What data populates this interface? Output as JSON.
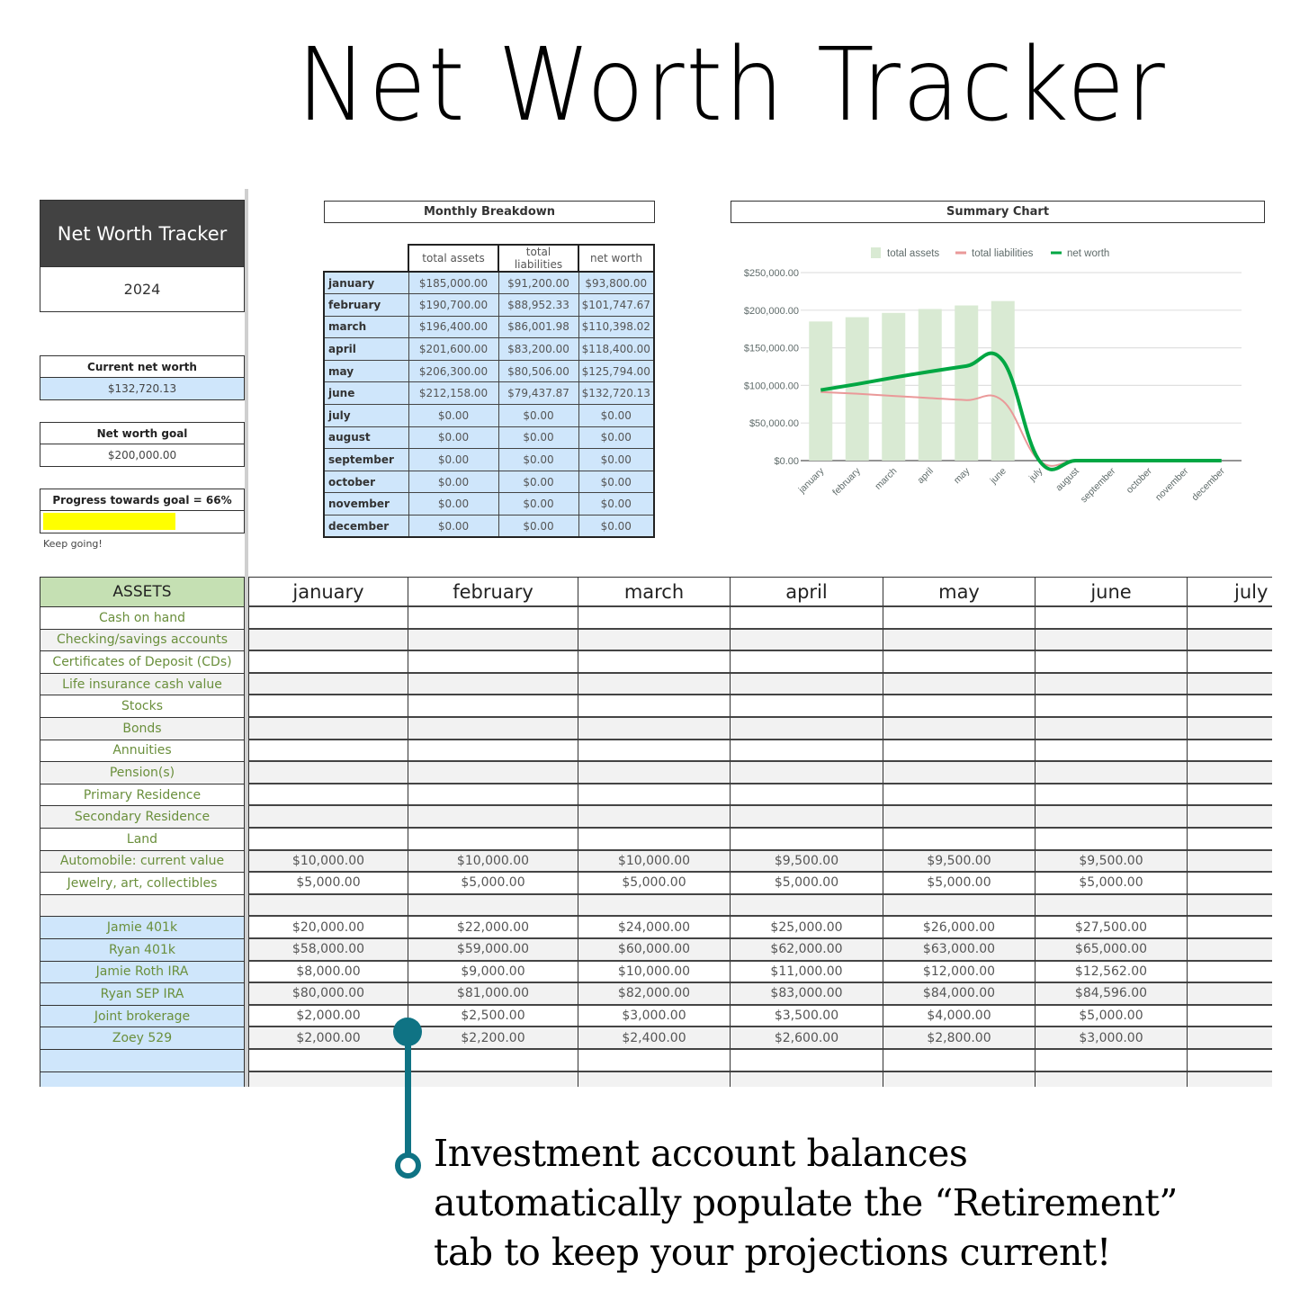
{
  "page": {
    "title": "Net Worth Tracker"
  },
  "summary_panel": {
    "header": "Net Worth Tracker",
    "year": "2024",
    "current_net_worth_label": "Current net worth",
    "current_net_worth_value": "$132,720.13",
    "goal_label": "Net worth goal",
    "goal_value": "$200,000.00",
    "progress_label": "Progress towards goal = 66%",
    "progress_fraction": 0.66,
    "progress_color": "#ffff00",
    "encouragement": "Keep going!"
  },
  "monthly_breakdown": {
    "title": "Monthly Breakdown",
    "columns": [
      "total assets",
      "total liabilities",
      "net worth"
    ],
    "rows": [
      {
        "month": "january",
        "assets": "$185,000.00",
        "liabilities": "$91,200.00",
        "net": "$93,800.00"
      },
      {
        "month": "february",
        "assets": "$190,700.00",
        "liabilities": "$88,952.33",
        "net": "$101,747.67"
      },
      {
        "month": "march",
        "assets": "$196,400.00",
        "liabilities": "$86,001.98",
        "net": "$110,398.02"
      },
      {
        "month": "april",
        "assets": "$201,600.00",
        "liabilities": "$83,200.00",
        "net": "$118,400.00"
      },
      {
        "month": "may",
        "assets": "$206,300.00",
        "liabilities": "$80,506.00",
        "net": "$125,794.00"
      },
      {
        "month": "june",
        "assets": "$212,158.00",
        "liabilities": "$79,437.87",
        "net": "$132,720.13"
      },
      {
        "month": "july",
        "assets": "$0.00",
        "liabilities": "$0.00",
        "net": "$0.00"
      },
      {
        "month": "august",
        "assets": "$0.00",
        "liabilities": "$0.00",
        "net": "$0.00"
      },
      {
        "month": "september",
        "assets": "$0.00",
        "liabilities": "$0.00",
        "net": "$0.00"
      },
      {
        "month": "october",
        "assets": "$0.00",
        "liabilities": "$0.00",
        "net": "$0.00"
      },
      {
        "month": "november",
        "assets": "$0.00",
        "liabilities": "$0.00",
        "net": "$0.00"
      },
      {
        "month": "december",
        "assets": "$0.00",
        "liabilities": "$0.00",
        "net": "$0.00"
      }
    ]
  },
  "summary_chart_title": "Summary Chart",
  "chart_data": {
    "type": "bar",
    "title": "Summary Chart",
    "categories": [
      "january",
      "february",
      "march",
      "april",
      "may",
      "june",
      "july",
      "august",
      "september",
      "october",
      "november",
      "december"
    ],
    "series": [
      {
        "name": "total assets",
        "kind": "bar",
        "color": "#d9ead3",
        "values": [
          185000,
          190700,
          196400,
          201600,
          206300,
          212158,
          0,
          0,
          0,
          0,
          0,
          0
        ]
      },
      {
        "name": "total liabilities",
        "kind": "line",
        "color": "#ea9999",
        "values": [
          91200,
          88952.33,
          86001.98,
          83200,
          80506,
          79437.87,
          0,
          0,
          0,
          0,
          0,
          0
        ]
      },
      {
        "name": "net worth",
        "kind": "line",
        "color": "#00a743",
        "values": [
          93800,
          101747.67,
          110398.02,
          118400,
          125794,
          132720.13,
          0,
          0,
          0,
          0,
          0,
          0
        ]
      }
    ],
    "y_ticks": [
      "$0.00",
      "$50,000.00",
      "$100,000.00",
      "$150,000.00",
      "$200,000.00",
      "$250,000.00"
    ],
    "ylim": [
      0,
      250000
    ],
    "xlabel": "",
    "ylabel": "",
    "legend": "top",
    "grid": true
  },
  "assets_grid": {
    "header_label": "ASSETS",
    "months": [
      "january",
      "february",
      "march",
      "april",
      "may",
      "june",
      "july"
    ],
    "rows": [
      {
        "label": "Cash on hand",
        "values": [
          "",
          "",
          "",
          "",
          "",
          "",
          ""
        ]
      },
      {
        "label": "Checking/savings accounts",
        "values": [
          "",
          "",
          "",
          "",
          "",
          "",
          ""
        ]
      },
      {
        "label": "Certificates of Deposit (CDs)",
        "values": [
          "",
          "",
          "",
          "",
          "",
          "",
          ""
        ]
      },
      {
        "label": "Life insurance cash value",
        "values": [
          "",
          "",
          "",
          "",
          "",
          "",
          ""
        ]
      },
      {
        "label": "Stocks",
        "values": [
          "",
          "",
          "",
          "",
          "",
          "",
          ""
        ]
      },
      {
        "label": "Bonds",
        "values": [
          "",
          "",
          "",
          "",
          "",
          "",
          ""
        ]
      },
      {
        "label": "Annuities",
        "values": [
          "",
          "",
          "",
          "",
          "",
          "",
          ""
        ]
      },
      {
        "label": "Pension(s)",
        "values": [
          "",
          "",
          "",
          "",
          "",
          "",
          ""
        ]
      },
      {
        "label": "Primary Residence",
        "values": [
          "",
          "",
          "",
          "",
          "",
          "",
          ""
        ]
      },
      {
        "label": "Secondary Residence",
        "values": [
          "",
          "",
          "",
          "",
          "",
          "",
          ""
        ]
      },
      {
        "label": "Land",
        "values": [
          "",
          "",
          "",
          "",
          "",
          "",
          ""
        ]
      },
      {
        "label": "Automobile: current value",
        "values": [
          "$10,000.00",
          "$10,000.00",
          "$10,000.00",
          "$9,500.00",
          "$9,500.00",
          "$9,500.00",
          ""
        ]
      },
      {
        "label": "Jewelry, art, collectibles",
        "values": [
          "$5,000.00",
          "$5,000.00",
          "$5,000.00",
          "$5,000.00",
          "$5,000.00",
          "$5,000.00",
          ""
        ]
      },
      {
        "label": "",
        "values": [
          "",
          "",
          "",
          "",
          "",
          "",
          ""
        ]
      },
      {
        "label": "Jamie 401k",
        "investment": true,
        "values": [
          "$20,000.00",
          "$22,000.00",
          "$24,000.00",
          "$25,000.00",
          "$26,000.00",
          "$27,500.00",
          ""
        ]
      },
      {
        "label": "Ryan 401k",
        "investment": true,
        "values": [
          "$58,000.00",
          "$59,000.00",
          "$60,000.00",
          "$62,000.00",
          "$63,000.00",
          "$65,000.00",
          ""
        ]
      },
      {
        "label": "Jamie Roth IRA",
        "investment": true,
        "values": [
          "$8,000.00",
          "$9,000.00",
          "$10,000.00",
          "$11,000.00",
          "$12,000.00",
          "$12,562.00",
          ""
        ]
      },
      {
        "label": "Ryan SEP IRA",
        "investment": true,
        "values": [
          "$80,000.00",
          "$81,000.00",
          "$82,000.00",
          "$83,000.00",
          "$84,000.00",
          "$84,596.00",
          ""
        ]
      },
      {
        "label": "Joint brokerage",
        "investment": true,
        "values": [
          "$2,000.00",
          "$2,500.00",
          "$3,000.00",
          "$3,500.00",
          "$4,000.00",
          "$5,000.00",
          ""
        ]
      },
      {
        "label": "Zoey 529",
        "investment": true,
        "values": [
          "$2,000.00",
          "$2,200.00",
          "$2,400.00",
          "$2,600.00",
          "$2,800.00",
          "$3,000.00",
          ""
        ]
      },
      {
        "label": "",
        "investment": true,
        "values": [
          "",
          "",
          "",
          "",
          "",
          "",
          ""
        ]
      },
      {
        "label": "",
        "investment": true,
        "values": [
          "",
          "",
          "",
          "",
          "",
          "",
          ""
        ]
      }
    ]
  },
  "annotation": {
    "lines": [
      "Investment account balances",
      "automatically populate the “Retirement”",
      "tab to keep your projections current!"
    ],
    "accent_color": "#0f7384"
  }
}
